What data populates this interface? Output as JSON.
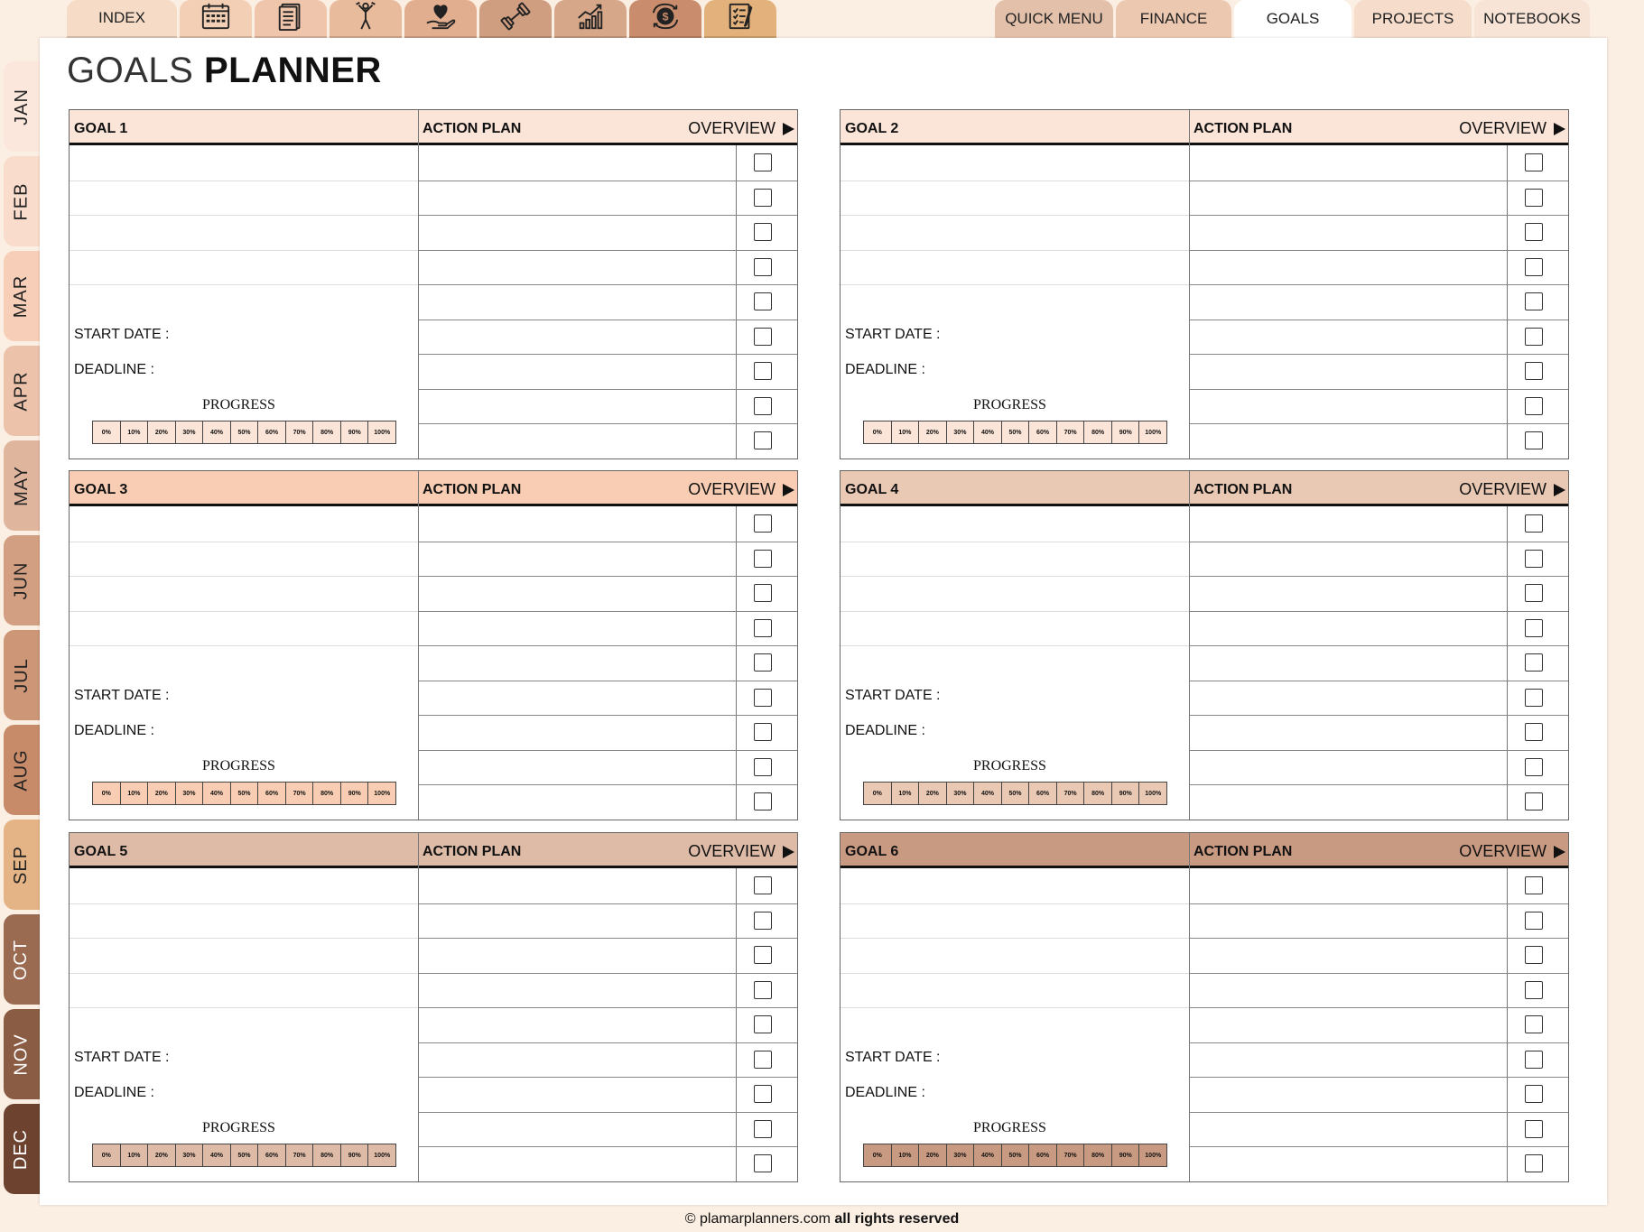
{
  "top_tabs": [
    {
      "label": "INDEX",
      "icon": "",
      "color": "#f6dcc7"
    },
    {
      "label": "",
      "icon": "calendar-icon",
      "color": "#f3cfb6"
    },
    {
      "label": "",
      "icon": "notes-icon",
      "color": "#efc6ab"
    },
    {
      "label": "",
      "icon": "fitness-person-icon",
      "color": "#e9bb9d"
    },
    {
      "label": "",
      "icon": "heart-hand-icon",
      "color": "#e2ae90"
    },
    {
      "label": "",
      "icon": "dumbbell-icon",
      "color": "#cf9d80"
    },
    {
      "label": "",
      "icon": "growth-chart-icon",
      "color": "#d7a78a"
    },
    {
      "label": "",
      "icon": "money-cycle-icon",
      "color": "#c98c6c"
    },
    {
      "label": "",
      "icon": "checklist-icon",
      "color": "#e3b27c"
    }
  ],
  "right_tabs": [
    {
      "label": "QUICK MENU",
      "color": "#e3c0aa"
    },
    {
      "label": "FINANCE",
      "color": "#ecc8b0"
    },
    {
      "label": "GOALS",
      "color": "#ffffff"
    },
    {
      "label": "PROJECTS",
      "color": "#f5dccb"
    },
    {
      "label": "NOTEBOOKS",
      "color": "#f7e4d6"
    }
  ],
  "months": [
    {
      "label": "JAN",
      "color": "#fbe7db"
    },
    {
      "label": "FEB",
      "color": "#f9dccb"
    },
    {
      "label": "MAR",
      "color": "#f7cfb8"
    },
    {
      "label": "APR",
      "color": "#ecc2ab"
    },
    {
      "label": "MAY",
      "color": "#e0b59e"
    },
    {
      "label": "JUN",
      "color": "#d39f82"
    },
    {
      "label": "JUL",
      "color": "#cc9677"
    },
    {
      "label": "AUG",
      "color": "#c88b69"
    },
    {
      "label": "SEP",
      "color": "#e4b486"
    },
    {
      "label": "OCT",
      "color": "#9a6b51"
    },
    {
      "label": "NOV",
      "color": "#8a5c43"
    },
    {
      "label": "DEC",
      "color": "#6d4330"
    }
  ],
  "title": {
    "light": "GOALS",
    "bold": "PLANNER"
  },
  "labels": {
    "action_plan": "ACTION PLAN",
    "overview": "OVERVIEW",
    "start_date": "START DATE :",
    "deadline": "DEADLINE :",
    "progress": "PROGRESS"
  },
  "progress_scale": [
    "0%",
    "10%",
    "20%",
    "30%",
    "40%",
    "50%",
    "60%",
    "70%",
    "80%",
    "90%",
    "100%"
  ],
  "goals": [
    {
      "name": "GOAL 1",
      "color": "#fbe4d8"
    },
    {
      "name": "GOAL 2",
      "color": "#fbe4d8"
    },
    {
      "name": "GOAL 3",
      "color": "#f8cdb3"
    },
    {
      "name": "GOAL 4",
      "color": "#e9c8b4"
    },
    {
      "name": "GOAL 5",
      "color": "#ddbba7"
    },
    {
      "name": "GOAL 6",
      "color": "#c99a82"
    }
  ],
  "footer": {
    "site": "© plamarplanners.com",
    "rights": "all rights reserved"
  }
}
